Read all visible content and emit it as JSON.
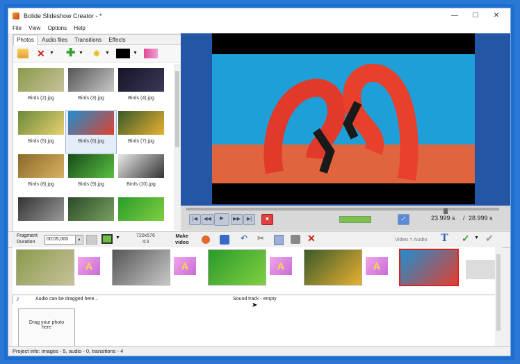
{
  "window": {
    "title": "Bolide Slideshow Creator - *",
    "minimize": "—",
    "maximize": "☐",
    "close": "✕"
  },
  "menu": [
    "File",
    "View",
    "Options",
    "Help"
  ],
  "tabs": [
    "Photos",
    "Audio files",
    "Transitions",
    "Effects"
  ],
  "photos": [
    {
      "caption": "Birds (2).jpg",
      "colors": [
        "#8b9a4a",
        "#c7c29a"
      ]
    },
    {
      "caption": "Birds (3).jpg",
      "colors": [
        "#555555",
        "#c8c8c8"
      ]
    },
    {
      "caption": "Birds (4).jpg",
      "colors": [
        "#141428",
        "#3a3a58"
      ]
    },
    {
      "caption": "Birds (5).jpg",
      "colors": [
        "#6a8a3a",
        "#e8d070"
      ]
    },
    {
      "caption": "Birds (6).jpg",
      "colors": [
        "#1f8fcf",
        "#e04030"
      ]
    },
    {
      "caption": "Birds (7).jpg",
      "colors": [
        "#3a5a2a",
        "#e8b030"
      ]
    },
    {
      "caption": "Birds (8).jpg",
      "colors": [
        "#8a6a2a",
        "#d8b060"
      ]
    },
    {
      "caption": "Birds (9).jpg",
      "colors": [
        "#1a4a1a",
        "#58c040"
      ]
    },
    {
      "caption": "Birds (10).jpg",
      "colors": [
        "#e8e8e8",
        "#333333"
      ]
    },
    {
      "caption": "",
      "colors": [
        "#333333",
        "#999999"
      ]
    },
    {
      "caption": "",
      "colors": [
        "#2a4a2a",
        "#7aa060"
      ]
    },
    {
      "caption": "",
      "colors": [
        "#2a9a2a",
        "#80d040"
      ]
    }
  ],
  "player": {
    "current_time": "23.999 s",
    "separator": "/",
    "total_time": "28.999 s"
  },
  "fragment": {
    "label_line1": "Fragment",
    "label_line2": "Duration",
    "value": "00:05,000",
    "resolution_line1": "720x576",
    "resolution_line2": "4:3",
    "make_video_line1": "Make",
    "make_video_line2": "video",
    "video_audio": "Video = Audio"
  },
  "timeline": {
    "slides": [
      {
        "colors": [
          "#8b9a4a",
          "#c7c29a"
        ],
        "selected": false
      },
      {
        "colors": [
          "#555555",
          "#c8c8c8"
        ],
        "selected": false
      },
      {
        "colors": [
          "#2a9a2a",
          "#80d040"
        ],
        "selected": false
      },
      {
        "colors": [
          "#3a5a2a",
          "#e8b030"
        ],
        "selected": false
      },
      {
        "colors": [
          "#1f8fcf",
          "#e04030"
        ],
        "selected": true
      }
    ],
    "transition_glyph": "A"
  },
  "sound": {
    "left": "Audio can be dragged here...",
    "center": "Sound track - empty"
  },
  "drop": {
    "line1": "Drag your photo",
    "line2": "here"
  },
  "status": "Project info: images - 5, audio - 0, transitions - 4",
  "colors": {
    "selection": "#e02020",
    "accent": "#2456a6"
  }
}
